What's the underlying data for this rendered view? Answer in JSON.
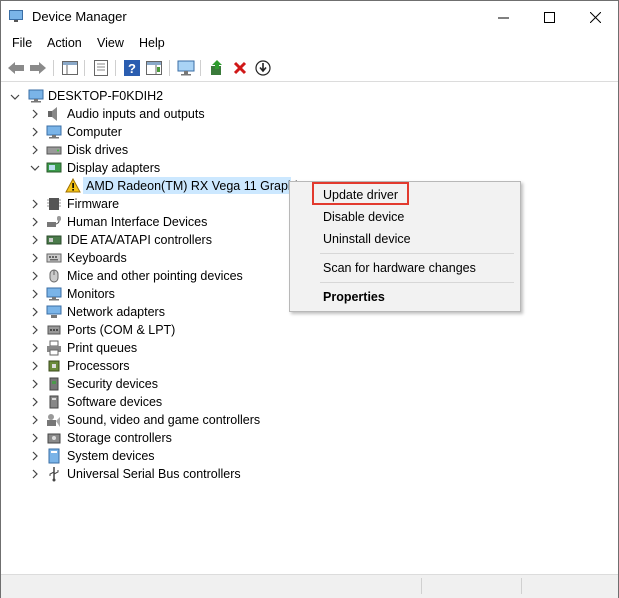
{
  "window": {
    "title": "Device Manager"
  },
  "menu": [
    "File",
    "Action",
    "View",
    "Help"
  ],
  "toolbar": [
    "back",
    "forward",
    "show-hide-console-tree",
    "properties",
    "help",
    "action-pane",
    "scan-hardware",
    "update-driver",
    "uninstall",
    "enable-device"
  ],
  "tree": {
    "root": "DESKTOP-F0KDIH2",
    "items": [
      {
        "label": "Audio inputs and outputs",
        "icon": "speaker-icon",
        "expanded": false
      },
      {
        "label": "Computer",
        "icon": "computer-icon",
        "expanded": false
      },
      {
        "label": "Disk drives",
        "icon": "disk-drive-icon",
        "expanded": false
      },
      {
        "label": "Display adapters",
        "icon": "display-adapter-icon",
        "expanded": true
      },
      {
        "label": "AMD Radeon(TM) RX Vega 11 Graphics",
        "icon": "warning-icon",
        "child": true,
        "selected": true
      },
      {
        "label": "Firmware",
        "icon": "firmware-icon",
        "expanded": false
      },
      {
        "label": "Human Interface Devices",
        "icon": "hid-icon",
        "expanded": false
      },
      {
        "label": "IDE ATA/ATAPI controllers",
        "icon": "ide-controller-icon",
        "expanded": false
      },
      {
        "label": "Keyboards",
        "icon": "keyboard-icon",
        "expanded": false
      },
      {
        "label": "Mice and other pointing devices",
        "icon": "mouse-icon",
        "expanded": false
      },
      {
        "label": "Monitors",
        "icon": "monitor-icon",
        "expanded": false
      },
      {
        "label": "Network adapters",
        "icon": "network-adapter-icon",
        "expanded": false
      },
      {
        "label": "Ports (COM & LPT)",
        "icon": "port-icon",
        "expanded": false
      },
      {
        "label": "Print queues",
        "icon": "printer-icon",
        "expanded": false
      },
      {
        "label": "Processors",
        "icon": "processor-icon",
        "expanded": false
      },
      {
        "label": "Security devices",
        "icon": "security-device-icon",
        "expanded": false
      },
      {
        "label": "Software devices",
        "icon": "software-device-icon",
        "expanded": false
      },
      {
        "label": "Sound, video and game controllers",
        "icon": "sound-controller-icon",
        "expanded": false
      },
      {
        "label": "Storage controllers",
        "icon": "storage-controller-icon",
        "expanded": false
      },
      {
        "label": "System devices",
        "icon": "system-device-icon",
        "expanded": false
      },
      {
        "label": "Universal Serial Bus controllers",
        "icon": "usb-icon",
        "expanded": false
      }
    ]
  },
  "context_menu": {
    "items": [
      {
        "label": "Update driver",
        "bold": false,
        "highlighted": true
      },
      {
        "label": "Disable device",
        "bold": false
      },
      {
        "label": "Uninstall device",
        "bold": false
      },
      {
        "label": "Scan for hardware changes",
        "bold": false
      },
      {
        "label": "Properties",
        "bold": true
      }
    ]
  },
  "colors": {
    "selection": "#cce8ff",
    "highlight_border": "#e23a2e",
    "menu_bg": "#f2f2f2"
  }
}
